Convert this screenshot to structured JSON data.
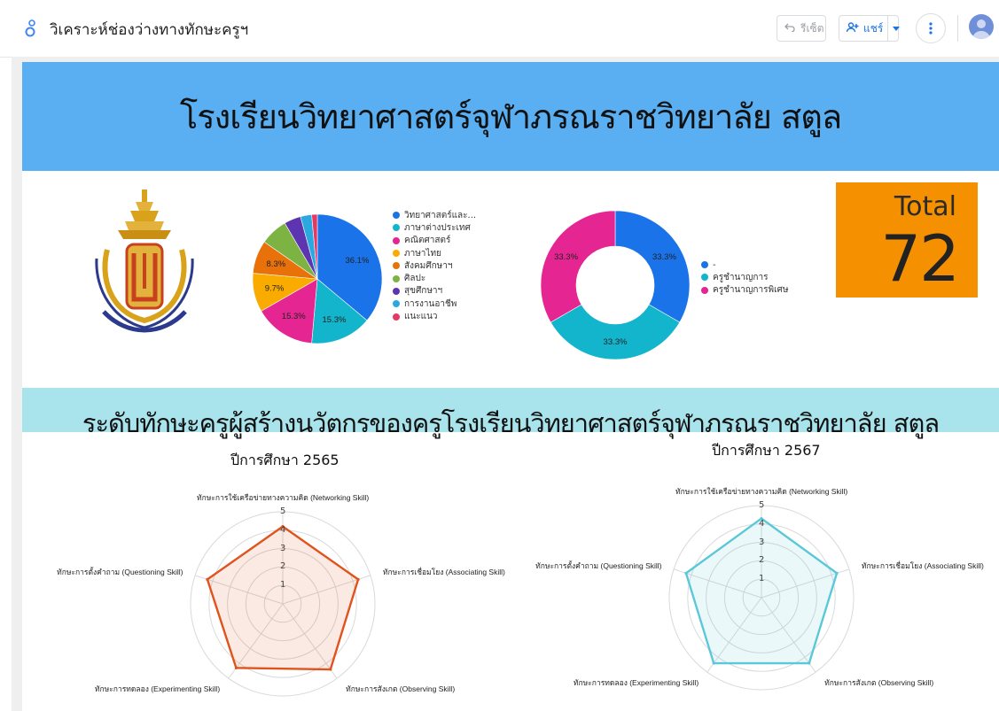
{
  "app": {
    "title": "วิเคราะห์ช่องว่างทางทักษะครูฯ",
    "reset_label": "รีเซ็ต",
    "share_label": "แชร์"
  },
  "report": {
    "school_title": "โรงเรียนวิทยาศาสตร์จุฬาภรณราชวิทยาลัย สตูล",
    "section_title": "ระดับทักษะครูผู้สร้างนวัตกรของครูโรงเรียนวิทยาศาสตร์จุฬาภรณราชวิทยาลัย สตูล",
    "total": {
      "label": "Total",
      "value": "72"
    }
  },
  "colors": {
    "header_band": "#5aaef2",
    "section_band": "#a9e3ec",
    "total_box": "#f59100",
    "radar_2565": "#e0531c",
    "radar_2567": "#5ac8d8"
  },
  "icons": [
    "data-studio-logo-icon",
    "undo-icon",
    "add-person-icon",
    "caret-down-icon",
    "more-vert-icon",
    "account-icon"
  ],
  "chart_data": [
    {
      "type": "pie",
      "categories": [
        "วิทยาศาสตร์และ...",
        "ภาษาต่างประเทศ",
        "คณิตศาสตร์",
        "ภาษาไทย",
        "สังคมศึกษาฯ",
        "ศิลปะ",
        "สุขศึกษาฯ",
        "การงานอาชีพ",
        "แนะแนว"
      ],
      "values": [
        36.1,
        15.3,
        15.3,
        9.7,
        8.3,
        6.9,
        4.2,
        2.8,
        1.4
      ],
      "labels": [
        "36.1%",
        "15.3%",
        "15.3%",
        "9.7%",
        "8.3%",
        "",
        "",
        "",
        ""
      ],
      "colors": [
        "#1a73e8",
        "#12b5cb",
        "#e52592",
        "#f9ab00",
        "#e8710a",
        "#7cb342",
        "#5e35b1",
        "#2aa9e0",
        "#e53964"
      ],
      "legend_position": "right"
    },
    {
      "type": "pie",
      "donut": true,
      "categories": [
        "-",
        "ครูชำนาญการ",
        "ครูชำนาญการพิเศษ"
      ],
      "values": [
        33.3,
        33.3,
        33.3
      ],
      "labels": [
        "33.3%",
        "33.3%",
        "33.3%"
      ],
      "colors": [
        "#1a73e8",
        "#12b5cb",
        "#e52592"
      ],
      "legend_position": "right"
    },
    {
      "type": "radar",
      "title": "ปีการศึกษา 2565",
      "axes": [
        "ทักษะการใช้เครือข่ายทางความคิด (Networking Skill)",
        "ทักษะการเชื่อมโยง (Associating Skill)",
        "ทักษะการสังเกต (Observing Skill)",
        "ทักษะการทดลอง (Experimenting Skill)",
        "ทักษะการตั้งคำถาม (Questioning Skill)"
      ],
      "values": [
        4.2,
        4.3,
        4.4,
        4.3,
        4.3
      ],
      "range": [
        0,
        5
      ],
      "ticks": [
        "1",
        "2",
        "3",
        "4",
        "5"
      ]
    },
    {
      "type": "radar",
      "title": "ปีการศึกษา 2567",
      "axes": [
        "ทักษะการใช้เครือข่ายทางความคิด (Networking Skill)",
        "ทักษะการเชื่อมโยง (Associating Skill)",
        "ทักษะการสังเกต (Observing Skill)",
        "ทักษะการทดลอง (Experimenting Skill)",
        "ทักษะการตั้งคำถาม (Questioning Skill)"
      ],
      "values": [
        4.3,
        4.3,
        4.4,
        4.4,
        4.3
      ],
      "range": [
        0,
        5
      ],
      "ticks": [
        "1",
        "2",
        "3",
        "4",
        "5"
      ]
    }
  ]
}
